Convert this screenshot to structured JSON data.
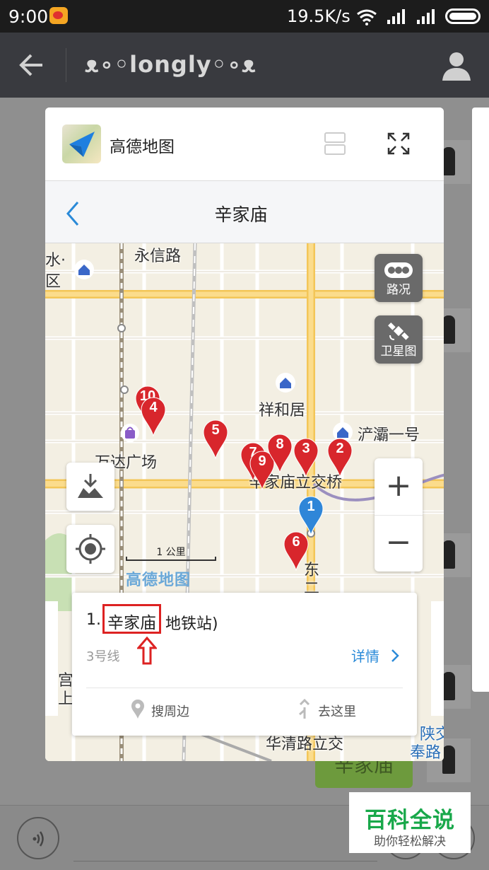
{
  "status_bar": {
    "time": "9:00",
    "net_speed": "19.5K/s",
    "icons": [
      "weibo-icon",
      "wifi-icon",
      "signal-icon",
      "signal-icon",
      "battery-icon"
    ]
  },
  "chat": {
    "title": "ᴥ∘◦longly◦∘ᴥ",
    "green_bubble_text": "辛家庙"
  },
  "card": {
    "app_name": "高德地图",
    "nav_title": "辛家庙",
    "map": {
      "labels": {
        "yongxin_road": "永信路",
        "water_district_1": "水·",
        "water_district_2": "区",
        "xiangheju": "祥和居",
        "chanba_yihao": "浐灞一号",
        "wanda_plaza": "万达广场",
        "xinjiamiao_bridge": "辛家庙立交桥",
        "east_1": "东",
        "east_2": "二",
        "gong": "宫",
        "shang": "上",
        "huaqing_bridge": "华清路立交",
        "shaanxi": "陕交",
        "fenglu": "奉路"
      },
      "traffic_label": "路况",
      "satellite_label": "卫星图",
      "zoom_in": "+",
      "zoom_out": "−",
      "scale_label": "1 公里",
      "logo": "高德地图",
      "pins": [
        {
          "num": "10",
          "color": "#d8262c"
        },
        {
          "num": "4",
          "color": "#d8262c"
        },
        {
          "num": "5",
          "color": "#d8262c"
        },
        {
          "num": "7",
          "color": "#d8262c"
        },
        {
          "num": "9",
          "color": "#d8262c"
        },
        {
          "num": "8",
          "color": "#d8262c"
        },
        {
          "num": "3",
          "color": "#d8262c"
        },
        {
          "num": "2",
          "color": "#d8262c"
        },
        {
          "num": "1",
          "color": "#2f86d8"
        },
        {
          "num": "6",
          "color": "#d8262c"
        }
      ]
    },
    "poi": {
      "number": "1.",
      "name": "辛家庙",
      "suffix": "地铁站)",
      "line": "3号线",
      "detail": "详情",
      "nearby": "搜周边",
      "go_here": "去这里"
    }
  },
  "watermark": {
    "title": "百科全说",
    "subtitle": "助你轻松解决"
  },
  "colors": {
    "accent": "#2a8ad8",
    "highlight_box": "#dd2222",
    "watermark_green": "#18a84a"
  }
}
